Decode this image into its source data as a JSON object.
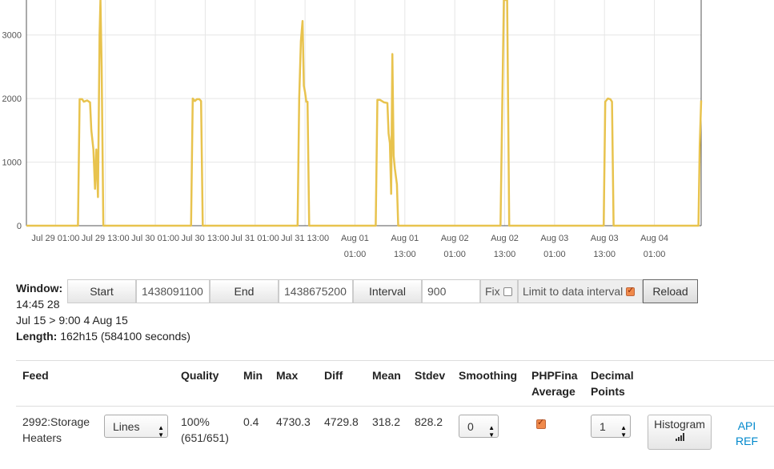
{
  "chart_data": {
    "type": "line",
    "y_ticks": [
      0,
      1000,
      2000,
      3000
    ],
    "ylim": [
      0,
      3550
    ],
    "x_ticks": [
      {
        "x_hours": 7,
        "lines": [
          "Jul 29 01:00"
        ]
      },
      {
        "x_hours": 19,
        "lines": [
          "Jul 29 13:00"
        ]
      },
      {
        "x_hours": 31,
        "lines": [
          "Jul 30 01:00"
        ]
      },
      {
        "x_hours": 43,
        "lines": [
          "Jul 30 13:00"
        ]
      },
      {
        "x_hours": 55,
        "lines": [
          "Jul 31 01:00"
        ]
      },
      {
        "x_hours": 67,
        "lines": [
          "Jul 31 13:00"
        ]
      },
      {
        "x_hours": 79,
        "lines": [
          "Aug 01",
          "01:00"
        ]
      },
      {
        "x_hours": 91,
        "lines": [
          "Aug 01",
          "13:00"
        ]
      },
      {
        "x_hours": 103,
        "lines": [
          "Aug 02",
          "01:00"
        ]
      },
      {
        "x_hours": 115,
        "lines": [
          "Aug 02",
          "13:00"
        ]
      },
      {
        "x_hours": 127,
        "lines": [
          "Aug 03",
          "01:00"
        ]
      },
      {
        "x_hours": 139,
        "lines": [
          "Aug 03",
          "13:00"
        ]
      },
      {
        "x_hours": 151,
        "lines": [
          "Aug 04",
          "01:00"
        ]
      }
    ],
    "xlim_hours": [
      0,
      162.25
    ],
    "grid": true,
    "series": [
      {
        "color": "#e8c34e",
        "points": [
          [
            0,
            0
          ],
          [
            12.4,
            0
          ],
          [
            12.8,
            1990
          ],
          [
            13.4,
            1990
          ],
          [
            13.8,
            1950
          ],
          [
            14.6,
            1970
          ],
          [
            15.3,
            1940
          ],
          [
            15.6,
            1500
          ],
          [
            16.1,
            1200
          ],
          [
            16.5,
            580
          ],
          [
            16.8,
            1200
          ],
          [
            17.2,
            450
          ],
          [
            17.6,
            3000
          ],
          [
            17.8,
            3550
          ],
          [
            18.1,
            2500
          ],
          [
            18.5,
            0
          ],
          [
            39.6,
            0
          ],
          [
            40.0,
            2000
          ],
          [
            40.5,
            1960
          ],
          [
            41.0,
            1990
          ],
          [
            41.6,
            1990
          ],
          [
            42.0,
            1960
          ],
          [
            42.4,
            0
          ],
          [
            65.2,
            0
          ],
          [
            65.6,
            2000
          ],
          [
            66.0,
            2900
          ],
          [
            66.4,
            3220
          ],
          [
            66.7,
            2200
          ],
          [
            67.0,
            2100
          ],
          [
            67.3,
            1950
          ],
          [
            67.6,
            1950
          ],
          [
            68.0,
            0
          ],
          [
            84.0,
            0
          ],
          [
            84.4,
            1980
          ],
          [
            85.0,
            1980
          ],
          [
            86.0,
            1940
          ],
          [
            86.8,
            1930
          ],
          [
            87.1,
            1450
          ],
          [
            87.4,
            1300
          ],
          [
            87.7,
            500
          ],
          [
            88.0,
            2700
          ],
          [
            88.3,
            1100
          ],
          [
            88.6,
            900
          ],
          [
            89.1,
            650
          ],
          [
            89.4,
            0
          ],
          [
            114.0,
            0
          ],
          [
            114.4,
            1800
          ],
          [
            114.8,
            3550
          ],
          [
            115.6,
            3550
          ],
          [
            116.1,
            0
          ],
          [
            138.8,
            0
          ],
          [
            139.2,
            1950
          ],
          [
            139.8,
            2000
          ],
          [
            140.4,
            1990
          ],
          [
            140.8,
            1950
          ],
          [
            141.2,
            0
          ],
          [
            161.6,
            0
          ],
          [
            161.9,
            1250
          ],
          [
            162.25,
            1970
          ]
        ]
      }
    ]
  },
  "window": {
    "label": "Window:",
    "time": "14:45 28",
    "range": "Jul 15 > 9:00 4 Aug 15",
    "length_label": "Length:",
    "length_value": "162h15 (584100 seconds)"
  },
  "controls": {
    "start_label": "Start",
    "start_value": "1438091100",
    "end_label": "End",
    "end_value": "1438675200",
    "interval_label": "Interval",
    "interval_value": "900",
    "fix_label": "Fix",
    "fix_checked": false,
    "limit_label": "Limit to data interval",
    "limit_checked": true,
    "reload_label": "Reload"
  },
  "table": {
    "headers": {
      "feed": "Feed",
      "quality": "Quality",
      "min": "Min",
      "max": "Max",
      "diff": "Diff",
      "mean": "Mean",
      "stdev": "Stdev",
      "smoothing": "Smoothing",
      "phpfina_1": "PHPFina",
      "phpfina_2": "Average",
      "decimal_1": "Decimal",
      "decimal_2": "Points"
    },
    "row": {
      "feed_1": "2992:Storage",
      "feed_2": "Heaters",
      "type": "Lines",
      "quality_1": "100%",
      "quality_2": "(651/651)",
      "min": "0.4",
      "max": "4730.3",
      "diff": "4729.8",
      "mean": "318.2",
      "stdev": "828.2",
      "smoothing": "0",
      "average_checked": true,
      "decimal": "1",
      "histogram_label": "Histogram",
      "api_1": "API",
      "api_2": "REF"
    }
  }
}
